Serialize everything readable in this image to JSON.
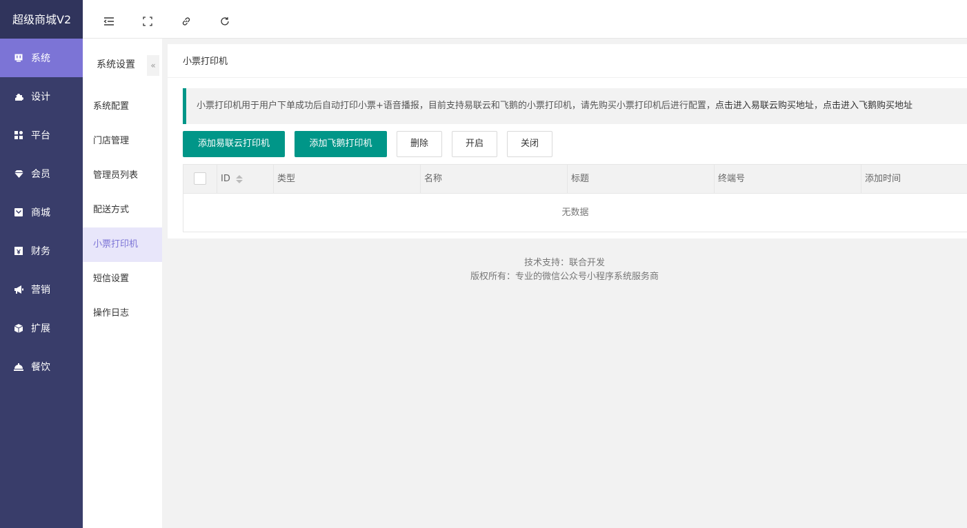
{
  "brand": "超级商城V2",
  "nav": {
    "items": [
      {
        "label": "系统",
        "icon": "monitor-icon",
        "active": true
      },
      {
        "label": "设计",
        "icon": "puzzle-icon"
      },
      {
        "label": "平台",
        "icon": "grid-icon"
      },
      {
        "label": "会员",
        "icon": "diamond-icon"
      },
      {
        "label": "商城",
        "icon": "mail-icon"
      },
      {
        "label": "财务",
        "icon": "yen-icon"
      },
      {
        "label": "营销",
        "icon": "megaphone-icon"
      },
      {
        "label": "扩展",
        "icon": "cube-icon"
      },
      {
        "label": "餐饮",
        "icon": "cloche-icon"
      }
    ]
  },
  "topbar": {
    "icons": [
      "menu-collapse-icon",
      "fullscreen-icon",
      "link-icon",
      "refresh-icon"
    ]
  },
  "subnav": {
    "title": "系统设置",
    "collapse_label": "«",
    "items": [
      {
        "label": "系统配置"
      },
      {
        "label": "门店管理"
      },
      {
        "label": "管理员列表"
      },
      {
        "label": "配送方式"
      },
      {
        "label": "小票打印机",
        "active": true
      },
      {
        "label": "短信设置"
      },
      {
        "label": "操作日志"
      }
    ]
  },
  "main": {
    "title": "小票打印机",
    "notice": {
      "text": "小票打印机用于用户下单成功后自动打印小票+语音播报，目前支持易联云和飞鹅的小票打印机，请先购买小票打印机后进行配置，",
      "link1": "点击进入易联云购买地址",
      "sep": "，",
      "link2": "点击进入飞鹅购买地址"
    },
    "buttons": {
      "add_yilianyun": "添加易联云打印机",
      "add_feie": "添加飞鹅打印机",
      "delete": "删除",
      "enable": "开启",
      "disable": "关闭"
    },
    "table": {
      "columns": [
        "ID",
        "类型",
        "名称",
        "标题",
        "终端号",
        "添加时间"
      ],
      "empty_text": "无数据"
    }
  },
  "footer": {
    "line1": "技术支持：联合开发",
    "line2": "版权所有：专业的微信公众号小程序系统服务商"
  },
  "colors": {
    "nav_bg": "#393d6a",
    "nav_active": "#7c74d6",
    "primary": "#009688",
    "sub_active_bg": "#e8e6fa"
  }
}
